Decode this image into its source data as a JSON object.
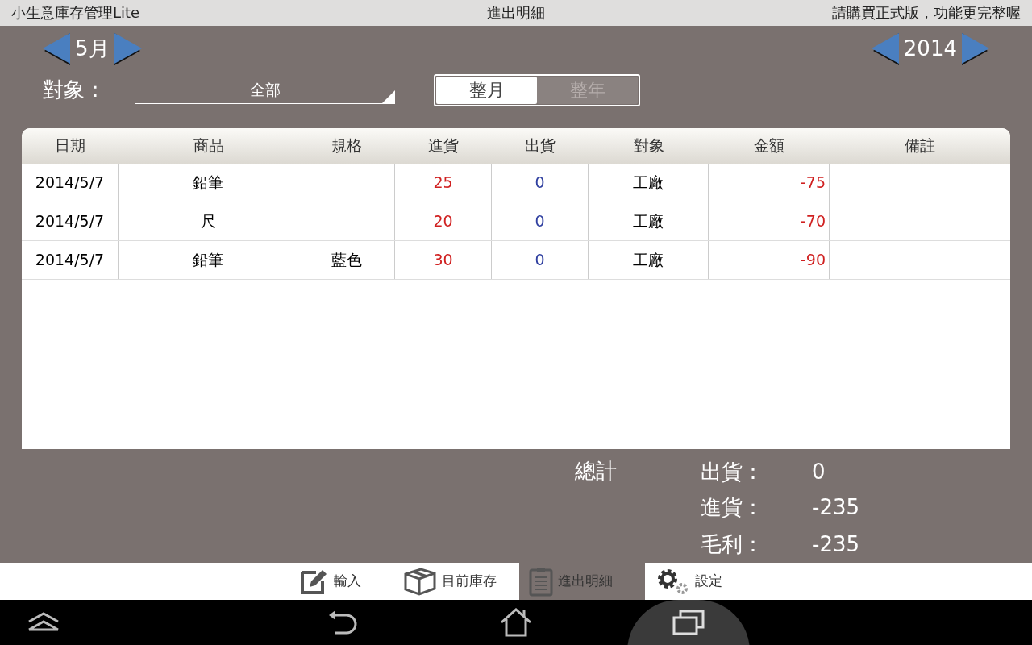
{
  "status_bar": {
    "app_name": "小生意庫存管理Lite",
    "title": "進出明細",
    "notice": "請購買正式版，功能更完整喔"
  },
  "month_picker": {
    "value": "5月"
  },
  "year_picker": {
    "value": "2014"
  },
  "filter": {
    "label": "對象：",
    "value": "全部"
  },
  "period_toggle": [
    {
      "label": "整月",
      "selected": true
    },
    {
      "label": "整年",
      "selected": false
    }
  ],
  "table": {
    "columns": [
      "日期",
      "商品",
      "規格",
      "進貨",
      "出貨",
      "對象",
      "金額",
      "備註"
    ],
    "rows": [
      {
        "date": "2014/5/7",
        "product": "鉛筆",
        "in": "25",
        "out": "0",
        "party": "工廠",
        "amount": "-75"
      },
      {
        "date": "2014/5/7",
        "product": "尺",
        "in": "20",
        "out": "0",
        "party": "工廠",
        "amount": "-70"
      },
      {
        "date": "2014/5/7",
        "product": "鉛筆",
        "spec": "藍色",
        "in": "30",
        "out": "0",
        "party": "工廠",
        "amount": "-90"
      }
    ]
  },
  "summary": {
    "label": "總計",
    "lines": [
      {
        "label": "出貨：",
        "value": "0"
      },
      {
        "label": "進貨：",
        "value": "-235"
      },
      {
        "label": "毛利：",
        "value": "-235"
      }
    ]
  },
  "bottom_tabs": [
    {
      "kind": "input",
      "label": "輸入",
      "selected": false
    },
    {
      "kind": "stock",
      "label": "目前庫存",
      "selected": false
    },
    {
      "kind": "detail",
      "label": "進出明細",
      "selected": true
    },
    {
      "kind": "settings",
      "label": "設定",
      "selected": false
    }
  ]
}
